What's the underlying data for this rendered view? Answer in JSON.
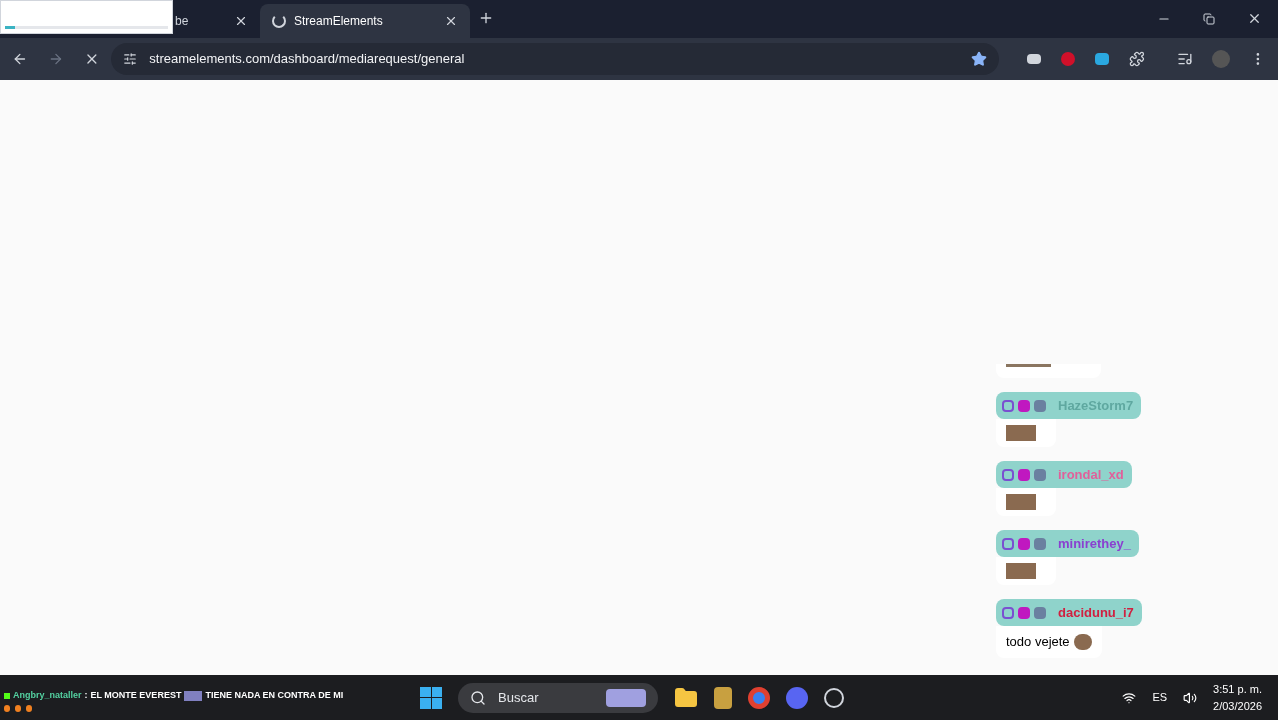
{
  "notification": {
    "level": 0.06
  },
  "tabs": [
    {
      "title": "be",
      "selected": false
    },
    {
      "title": "StreamElements",
      "selected": true
    }
  ],
  "address": {
    "url": "streamelements.com/dashboard/mediarequest/general",
    "bookmarked": true
  },
  "chat": [
    {
      "username": "HazeStorm7",
      "color": "#5fa8a0"
    },
    {
      "username": "irondal_xd",
      "color": "#e0609a"
    },
    {
      "username": "minirethey_",
      "color": "#8a40d0"
    },
    {
      "username": "dacidunu_i7",
      "color": "#d02040",
      "message": "todo vejete"
    }
  ],
  "ticker": {
    "user": "Angbry_nataller",
    "separator": ":",
    "text_before": "EL MONTE EVEREST",
    "text_after": "TIENE NADA EN CONTRA DE MI"
  },
  "taskbar": {
    "search_placeholder": "Buscar",
    "language": "ES",
    "time": "3:51 p. m.",
    "date": "2/03/2026"
  }
}
